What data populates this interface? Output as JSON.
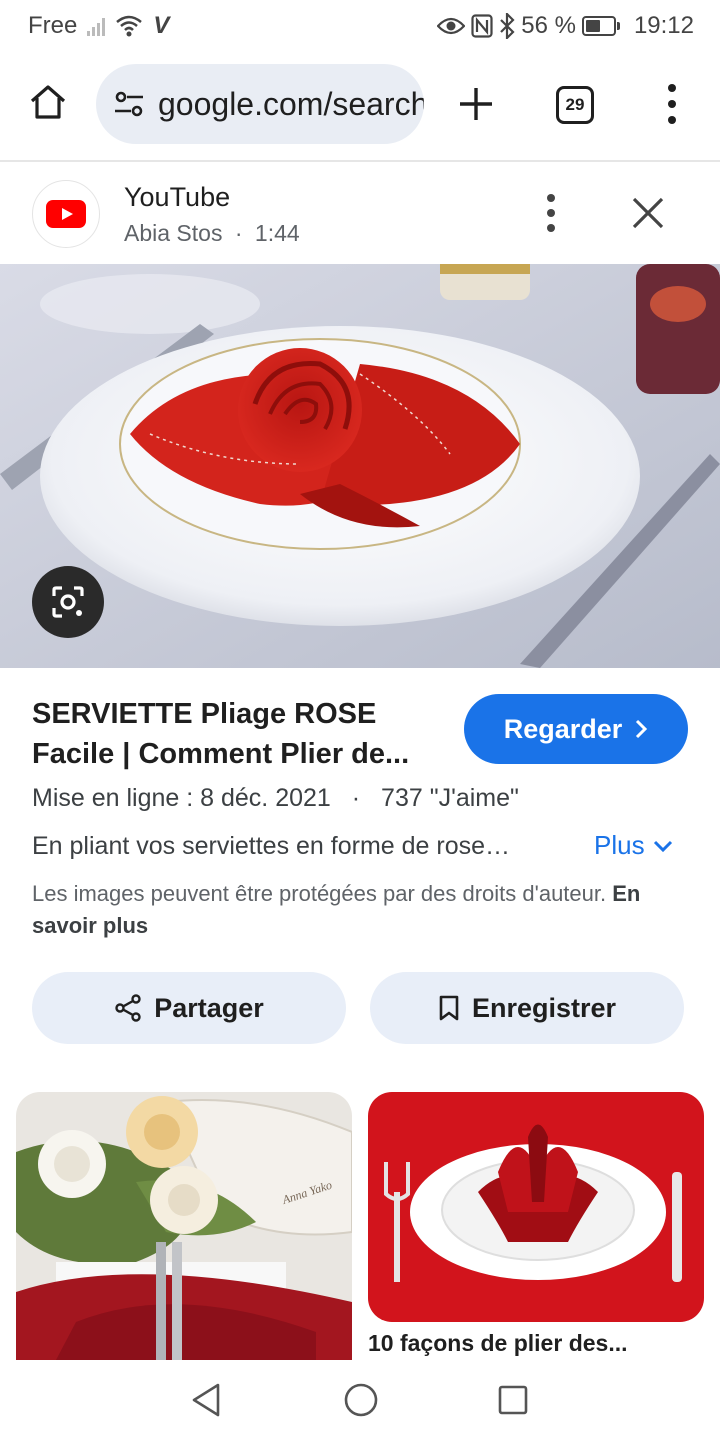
{
  "status_bar": {
    "carrier": "Free",
    "carrier_icon_letter": "V",
    "battery_percent_text": "56 %",
    "battery_level": 0.56,
    "time": "19:12",
    "icons": [
      "signal-bars-icon",
      "wifi-icon",
      "eye-icon",
      "nfc-icon",
      "bluetooth-icon",
      "battery-icon"
    ]
  },
  "browser": {
    "url": "google.com/search",
    "tab_count": "29",
    "icons": [
      "home-icon",
      "tune-icon",
      "plus-icon",
      "tab-switcher-icon",
      "overflow-menu-icon"
    ]
  },
  "source": {
    "name": "YouTube",
    "channel": "Abia Stos",
    "separator": "·",
    "duration": "1:44"
  },
  "video": {
    "title_line1": "SERVIETTE Pliage ROSE",
    "title_line2": "Facile | Comment Plier de...",
    "watch_label": "Regarder",
    "upload": "Mise en ligne : 8 déc. 2021",
    "meta_separator": "·",
    "likes": "737 \"J'aime\"",
    "description": "En pliant vos serviettes en forme de rose…",
    "more_label": "Plus",
    "copyright_text": "Les images peuvent être protégées par des droits d'auteur.",
    "learn_more": "En savoir plus"
  },
  "actions": {
    "share_label": "Partager",
    "save_label": "Enregistrer"
  },
  "related": {
    "item1_watermark": "Anna Yako",
    "item2_caption": "10 façons de plier des..."
  },
  "colors": {
    "accent": "#1a73e8",
    "chip_bg": "#e8eef8",
    "url_bg": "#e9edf4",
    "youtube_red": "#ff0000",
    "napkin_red": "#d0221c"
  }
}
